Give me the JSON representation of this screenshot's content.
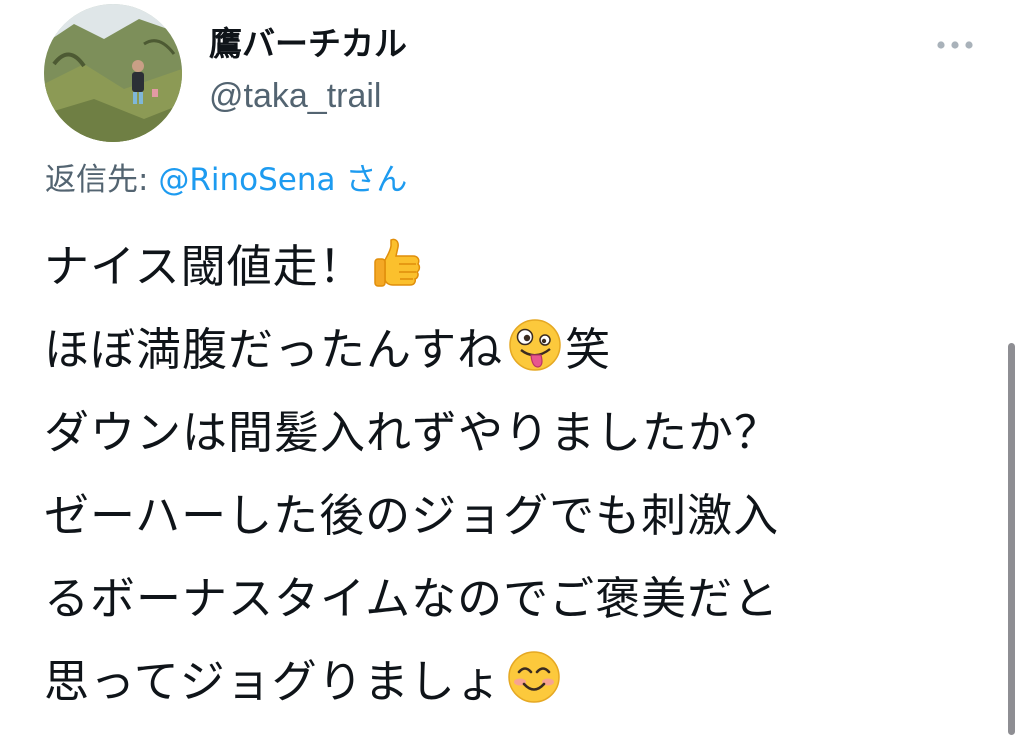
{
  "tweet": {
    "display_name": "鷹バーチカル",
    "handle": "@taka_trail",
    "reply": {
      "prefix": "返信先: ",
      "mention": "@RinoSena",
      "suffix": " さん"
    },
    "body_lines": [
      "ナイス閾値走！",
      "ほぼ満腹だったんすね",
      "笑",
      "ダウンは間髪入れずやりましたか？",
      "ゼーハーした後のジョグでも刺激入",
      "るボーナスタイムなのでご褒美だと",
      "思ってジョグりましょ"
    ],
    "emojis": [
      "thumbs-up-icon",
      "zany-face-icon",
      "smiling-face-icon"
    ]
  },
  "colors": {
    "text": "#0f1419",
    "secondary": "#536471",
    "link": "#1d9bf0",
    "scrollbar": "#8e8e93"
  },
  "icons": {
    "more": "more-horizontal-icon"
  }
}
